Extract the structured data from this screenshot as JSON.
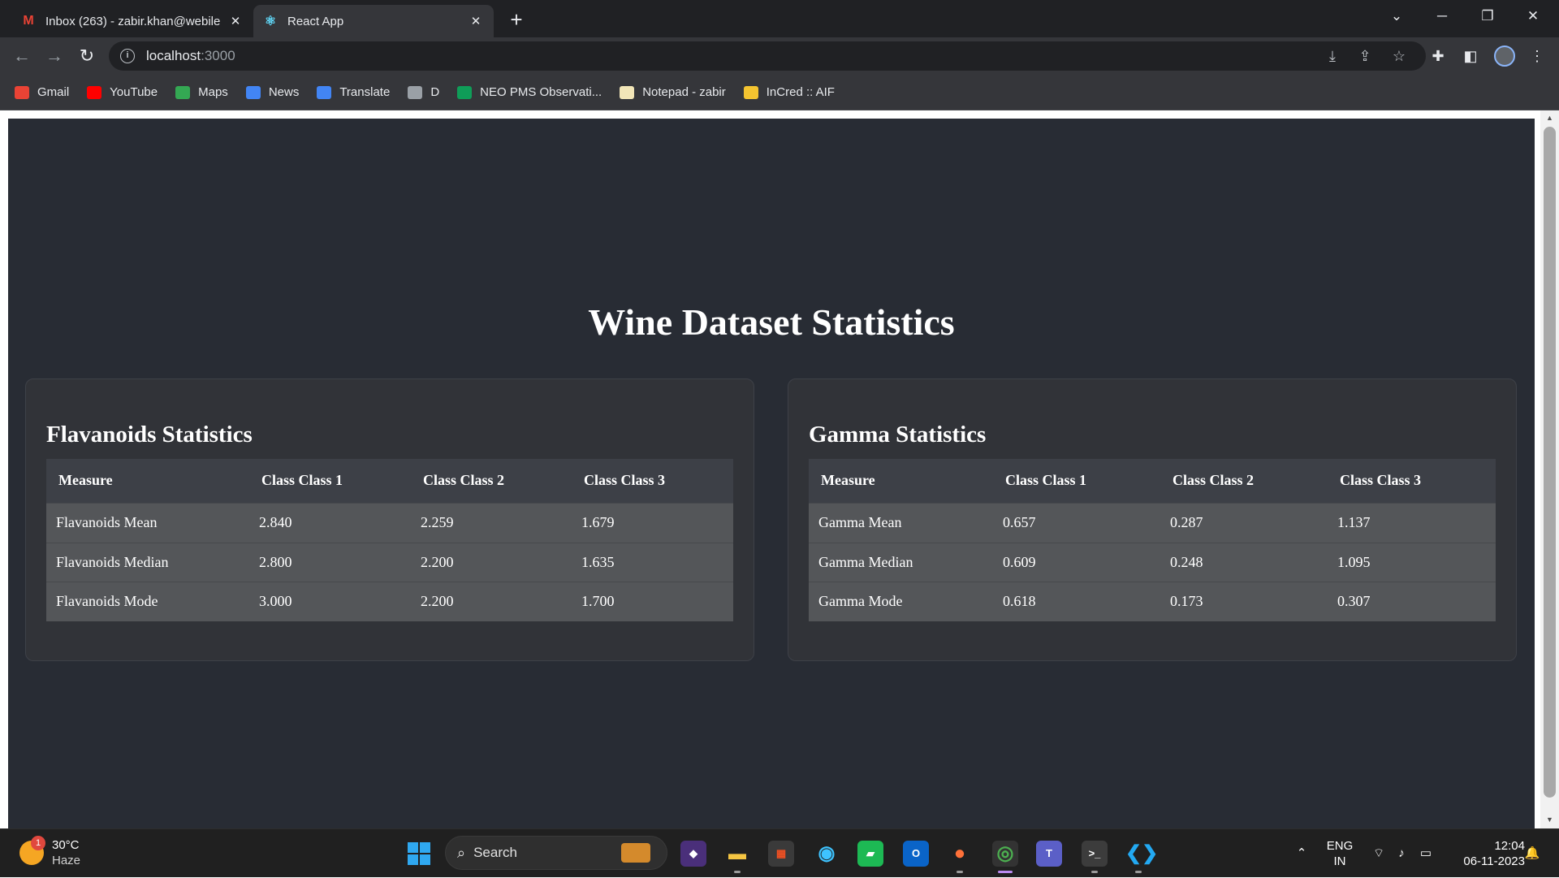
{
  "browser": {
    "tabs": [
      {
        "title": "Inbox (263) - zabir.khan@webile",
        "favicon": "gmail-icon"
      },
      {
        "title": "React App",
        "favicon": "react-icon"
      }
    ],
    "address": {
      "host": "localhost",
      "port": ":3000"
    },
    "bookmarks": [
      {
        "label": "Gmail",
        "icon": "gmail-icon",
        "color": "#ea4335"
      },
      {
        "label": "YouTube",
        "icon": "youtube-icon",
        "color": "#ff0000"
      },
      {
        "label": "Maps",
        "icon": "maps-icon",
        "color": "#34a853"
      },
      {
        "label": "News",
        "icon": "news-icon",
        "color": "#4285f4"
      },
      {
        "label": "Translate",
        "icon": "translate-icon",
        "color": "#4285f4"
      },
      {
        "label": "D",
        "icon": "globe-icon",
        "color": "#9aa0a6"
      },
      {
        "label": "NEO PMS Observati...",
        "icon": "sheets-icon",
        "color": "#0f9d58"
      },
      {
        "label": "Notepad - zabir",
        "icon": "notepad-icon",
        "color": "#f2e6b8"
      },
      {
        "label": "InCred :: AIF",
        "icon": "incred-icon",
        "color": "#f4c430"
      }
    ]
  },
  "page": {
    "title": "Wine Dataset Statistics",
    "flavanoids": {
      "heading": "Flavanoids Statistics",
      "columns": [
        "Measure",
        "Class Class 1",
        "Class Class 2",
        "Class Class 3"
      ],
      "rows": [
        [
          "Flavanoids Mean",
          "2.840",
          "2.259",
          "1.679"
        ],
        [
          "Flavanoids Median",
          "2.800",
          "2.200",
          "1.635"
        ],
        [
          "Flavanoids Mode",
          "3.000",
          "2.200",
          "1.700"
        ]
      ]
    },
    "gamma": {
      "heading": "Gamma Statistics",
      "columns": [
        "Measure",
        "Class Class 1",
        "Class Class 2",
        "Class Class 3"
      ],
      "rows": [
        [
          "Gamma Mean",
          "0.657",
          "0.287",
          "1.137"
        ],
        [
          "Gamma Median",
          "0.609",
          "0.248",
          "1.095"
        ],
        [
          "Gamma Mode",
          "0.618",
          "0.173",
          "0.307"
        ]
      ]
    }
  },
  "taskbar": {
    "weather": {
      "temp": "30°C",
      "condition": "Haze",
      "badge": "1"
    },
    "search_label": "Search",
    "language": {
      "line1": "ENG",
      "line2": "IN"
    },
    "clock": {
      "time": "12:04",
      "date": "06-11-2023"
    }
  },
  "colors": {
    "page_bg": "#282c34",
    "card_bg": "#313338",
    "table_header": "#3d4047",
    "table_row": "#545659"
  }
}
